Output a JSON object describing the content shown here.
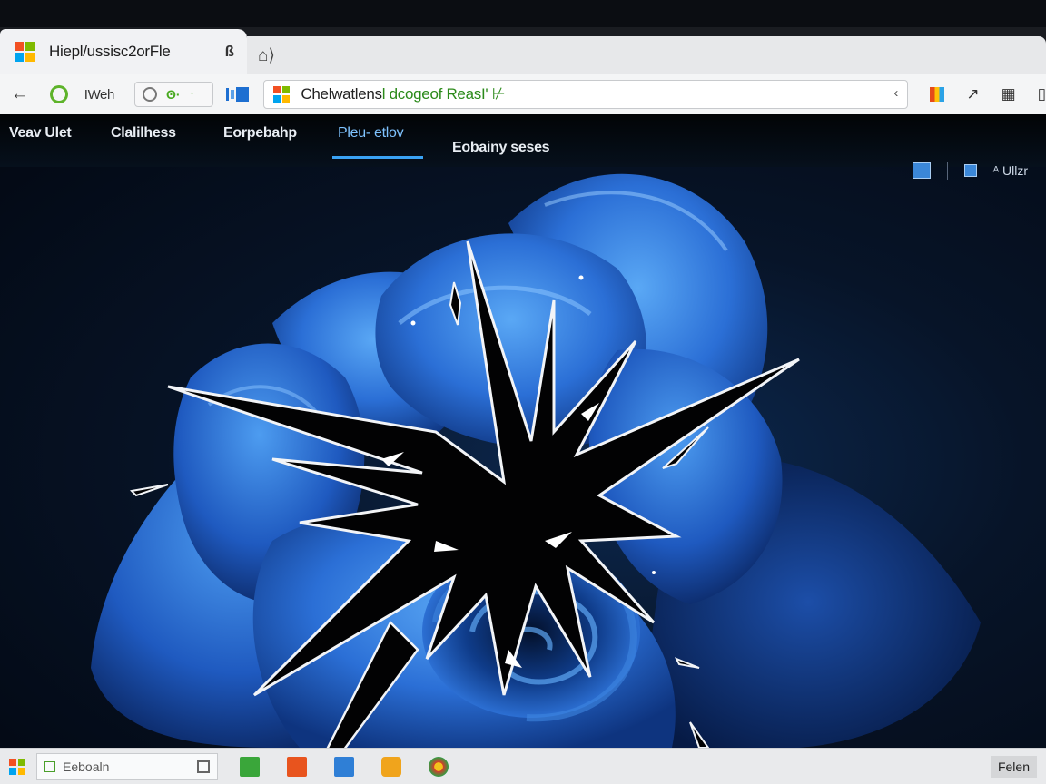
{
  "browser": {
    "tab_title": "Hiepl/ussisc2orFle",
    "tab_close": "ß",
    "new_tab": "⌂⟩",
    "back": "←",
    "toolbar_label": "IWeh",
    "ext_a": "ʘ·",
    "ext_b": "↑",
    "url_main": "Chelwatlens",
    "url_tail": "l dcogeof ReasI' ⊬",
    "addr_icon": "‹",
    "right_icons": [
      "↗",
      "▦",
      "▯"
    ]
  },
  "site": {
    "nav": [
      {
        "label": "Veav Ulet"
      },
      {
        "label": "Clalilhess"
      },
      {
        "label": "Eorpebahp"
      },
      {
        "label": "Pleu- etlov"
      },
      {
        "label": "Eobainy seses"
      }
    ],
    "active_index": 3,
    "user": "ᴬ Ullzr"
  },
  "taskbar": {
    "search_label": "Eeboaln",
    "tray_label": "Felen"
  },
  "colors": {
    "ms_red": "#f25022",
    "ms_green": "#7fba00",
    "ms_blue": "#00a4ef",
    "ms_yellow": "#ffb900",
    "accent": "#3aa2f4",
    "rose_light": "#3f8fe6",
    "rose_mid": "#1f5fc4",
    "rose_dark": "#0b2a6e"
  },
  "icons": [
    "windows-logo-icon",
    "back-arrow-icon",
    "refresh-icon",
    "shield-icon",
    "crack-burst-icon"
  ]
}
